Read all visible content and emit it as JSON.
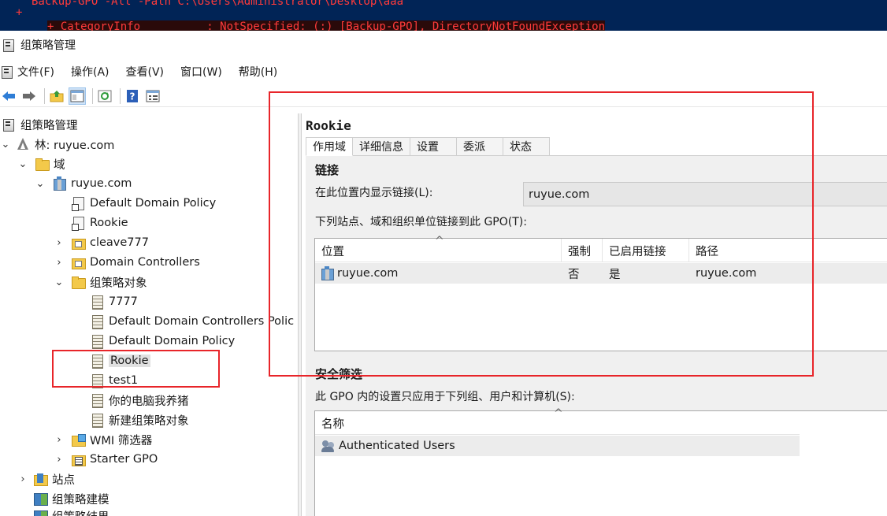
{
  "terminal": {
    "line1": "Backup-GPO -All -Path C:\\Users\\Administrator\\Desktop\\aaa",
    "plus": "+",
    "line2": "+ CategoryInfo          : NotSpecified: (:) [Backup-GPO], DirectoryNotFoundException"
  },
  "window": {
    "title": "组策略管理"
  },
  "menu": [
    {
      "label": "文件(F)"
    },
    {
      "label": "操作(A)"
    },
    {
      "label": "查看(V)"
    },
    {
      "label": "窗口(W)"
    },
    {
      "label": "帮助(H)"
    }
  ],
  "toolbar": [
    "back-arrow-icon",
    "forward-arrow-icon",
    "up-folder-icon",
    "show-hide-tree-icon",
    "refresh-icon",
    "help-icon",
    "properties-icon"
  ],
  "tree": {
    "root": "组策略管理",
    "forest": "林: ruyue.com",
    "domains": "域",
    "domain": "ruyue.com",
    "default_domain_policy_link": "Default Domain Policy",
    "rookie_link": "Rookie",
    "cleave": "cleave777",
    "domain_controllers": "Domain Controllers",
    "gpo_objects": "组策略对象",
    "gpos": [
      {
        "label": "7777"
      },
      {
        "label": "Default Domain Controllers Polic"
      },
      {
        "label": "Default Domain Policy"
      },
      {
        "label": "Rookie"
      },
      {
        "label": "test1"
      },
      {
        "label": "你的电脑我养猪"
      },
      {
        "label": "新建组策略对象"
      }
    ],
    "wmi": "WMI 筛选器",
    "starter": "Starter GPO",
    "sites": "站点",
    "modeling": "组策略建模",
    "results": "组策略结果"
  },
  "panel": {
    "title": "Rookie",
    "tabs": [
      {
        "label": "作用域"
      },
      {
        "label": "详细信息"
      },
      {
        "label": "设置"
      },
      {
        "label": "委派"
      },
      {
        "label": "状态"
      }
    ],
    "links_heading": "链接",
    "show_links_label": "在此位置内显示链接(L):",
    "show_links_value": "ruyue.com",
    "linked_label": "下列站点、域和组织单位链接到此 GPO(T):",
    "links_columns": [
      "位置",
      "强制",
      "已启用链接",
      "路径"
    ],
    "links_rows": [
      {
        "location": "ruyue.com",
        "enforced": "否",
        "enabled": "是",
        "path": "ruyue.com"
      }
    ],
    "security_heading": "安全筛选",
    "security_label": "此 GPO 内的设置只应用于下列组、用户和计算机(S):",
    "security_columns": [
      "名称"
    ],
    "security_rows": [
      {
        "name": "Authenticated Users"
      }
    ]
  },
  "colors": {
    "annotation": "#e8252a",
    "terminal_bg": "#012456"
  }
}
